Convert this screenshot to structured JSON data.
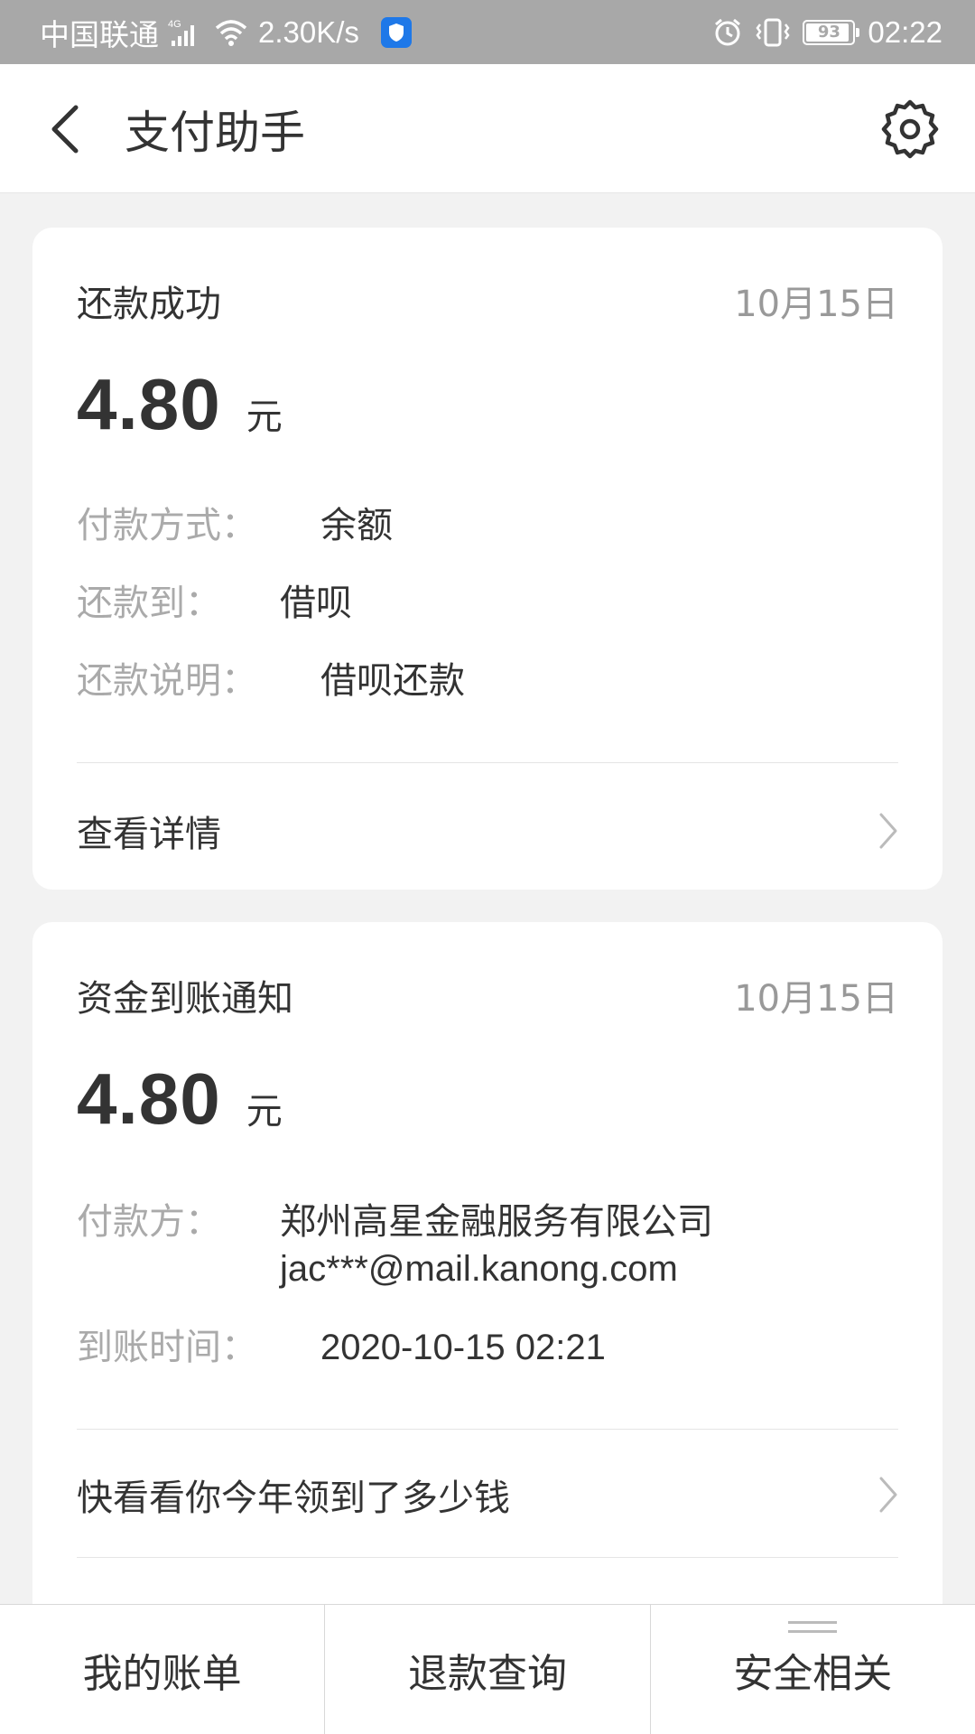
{
  "status_bar": {
    "carrier": "中国联通",
    "network": "4G",
    "speed": "2.30K/s",
    "battery": "93",
    "time": "02:22",
    "icons": [
      "signal-icon",
      "wifi-icon",
      "shield-icon",
      "alarm-icon",
      "vibrate-icon",
      "battery-icon"
    ]
  },
  "header": {
    "title": "支付助手",
    "back_icon": "back-arrow-icon",
    "settings_icon": "gear-icon"
  },
  "cards": [
    {
      "title": "还款成功",
      "date": "10月15日",
      "amount": "4.80",
      "unit": "元",
      "fields": [
        {
          "label": "付款方式：",
          "value": "余额"
        },
        {
          "label": "还款到：",
          "value": "借呗"
        },
        {
          "label": "还款说明：",
          "value": "借呗还款"
        }
      ],
      "link": "查看详情"
    },
    {
      "title": "资金到账通知",
      "date": "10月15日",
      "amount": "4.80",
      "unit": "元",
      "fields": [
        {
          "label": "付款方：",
          "value": "郑州高星金融服务有限公司",
          "value2": "jac***@mail.kanong.com"
        },
        {
          "label": "到账时间：",
          "value": "2020-10-15 02:21"
        }
      ],
      "link": "快看看你今年领到了多少钱"
    }
  ],
  "bottom_tabs": [
    {
      "label": "我的账单"
    },
    {
      "label": "退款查询"
    },
    {
      "label": "安全相关",
      "icon": "menu-lines-icon"
    }
  ],
  "colors": {
    "status_bar_bg": "#a8a8a8",
    "page_bg": "#f2f2f2",
    "card_bg": "#ffffff",
    "label_gray": "#aaaaaa",
    "date_gray": "#999999",
    "text_dark": "#333333",
    "shield_blue": "#1e78e8"
  }
}
